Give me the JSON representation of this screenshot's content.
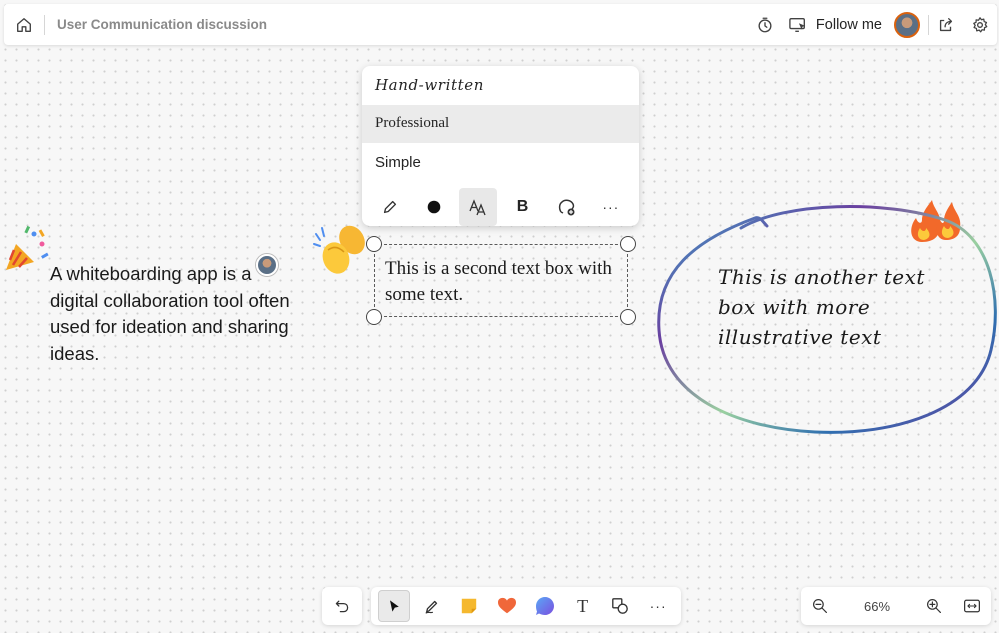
{
  "header": {
    "title": "User Communication discussion",
    "follow_label": "Follow me",
    "icons": [
      "home-icon",
      "timer-icon",
      "present-icon",
      "share-icon",
      "settings-icon"
    ]
  },
  "font_menu": {
    "options": [
      {
        "label": "Hand-written",
        "selected": false
      },
      {
        "label": "Professional",
        "selected": true
      },
      {
        "label": "Simple",
        "selected": false
      }
    ],
    "tools": [
      "pen-icon",
      "color-dot-icon",
      "font-icon",
      "bold-icon",
      "reaction-add-icon",
      "more-icon"
    ],
    "bold_label": "B",
    "more_label": "···"
  },
  "canvas": {
    "left_text": "A whiteboarding app is a digital collaboration tool often used for ideation and sharing ideas.",
    "selected_text": "This is a second text box with some text.",
    "circle_text": "This is another text box with more illustrative text",
    "circle_colors": [
      "#6a3fa0",
      "#3aa8c9",
      "#9ad0a0",
      "#2f6fb0"
    ],
    "reactions": [
      "confetti-icon",
      "clap-icon",
      "fire-icon"
    ]
  },
  "toolbar": {
    "tools": [
      "undo-icon",
      "select-icon",
      "pen-icon",
      "sticky-note-icon",
      "heart-icon",
      "comment-icon",
      "text-icon",
      "shapes-icon",
      "more-icon"
    ],
    "text_label": "T",
    "more_label": "···",
    "sticky_color": "#f5b82e",
    "heart_color": "#f0673a"
  },
  "zoom": {
    "level": "66%"
  }
}
